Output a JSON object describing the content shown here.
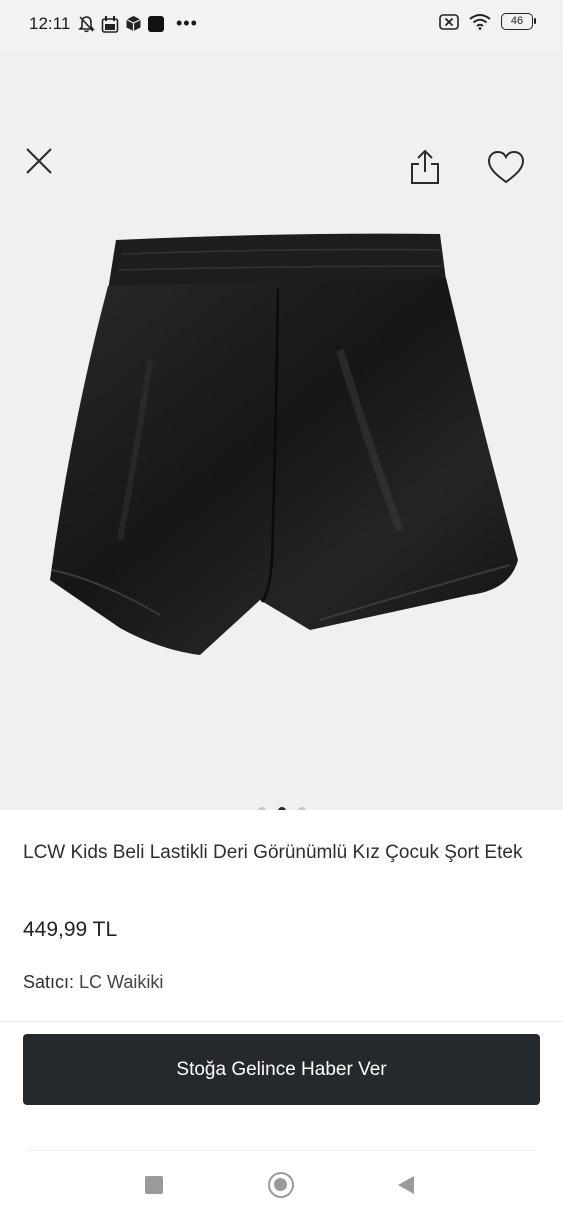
{
  "status_bar": {
    "time": "12:11",
    "battery": "46",
    "overflow": "•••"
  },
  "gallery": {
    "page_count": 3,
    "active_page": 2,
    "icons": {
      "close": "close-icon",
      "share": "share-icon",
      "favorite": "heart-icon"
    }
  },
  "product": {
    "title": "LCW Kids Beli Lastikli Deri Görünümlü Kız Çocuk Şort Etek",
    "price": "449,99 TL",
    "seller_label": "Satıcı:",
    "seller_name": "LC Waikiki"
  },
  "actions": {
    "notify_label": "Stoğa Gelince Haber Ver"
  },
  "colors": {
    "gallery_bg": "#f0f0f2",
    "button_bg": "#25282d",
    "product_fill": "#1b1b1b"
  }
}
